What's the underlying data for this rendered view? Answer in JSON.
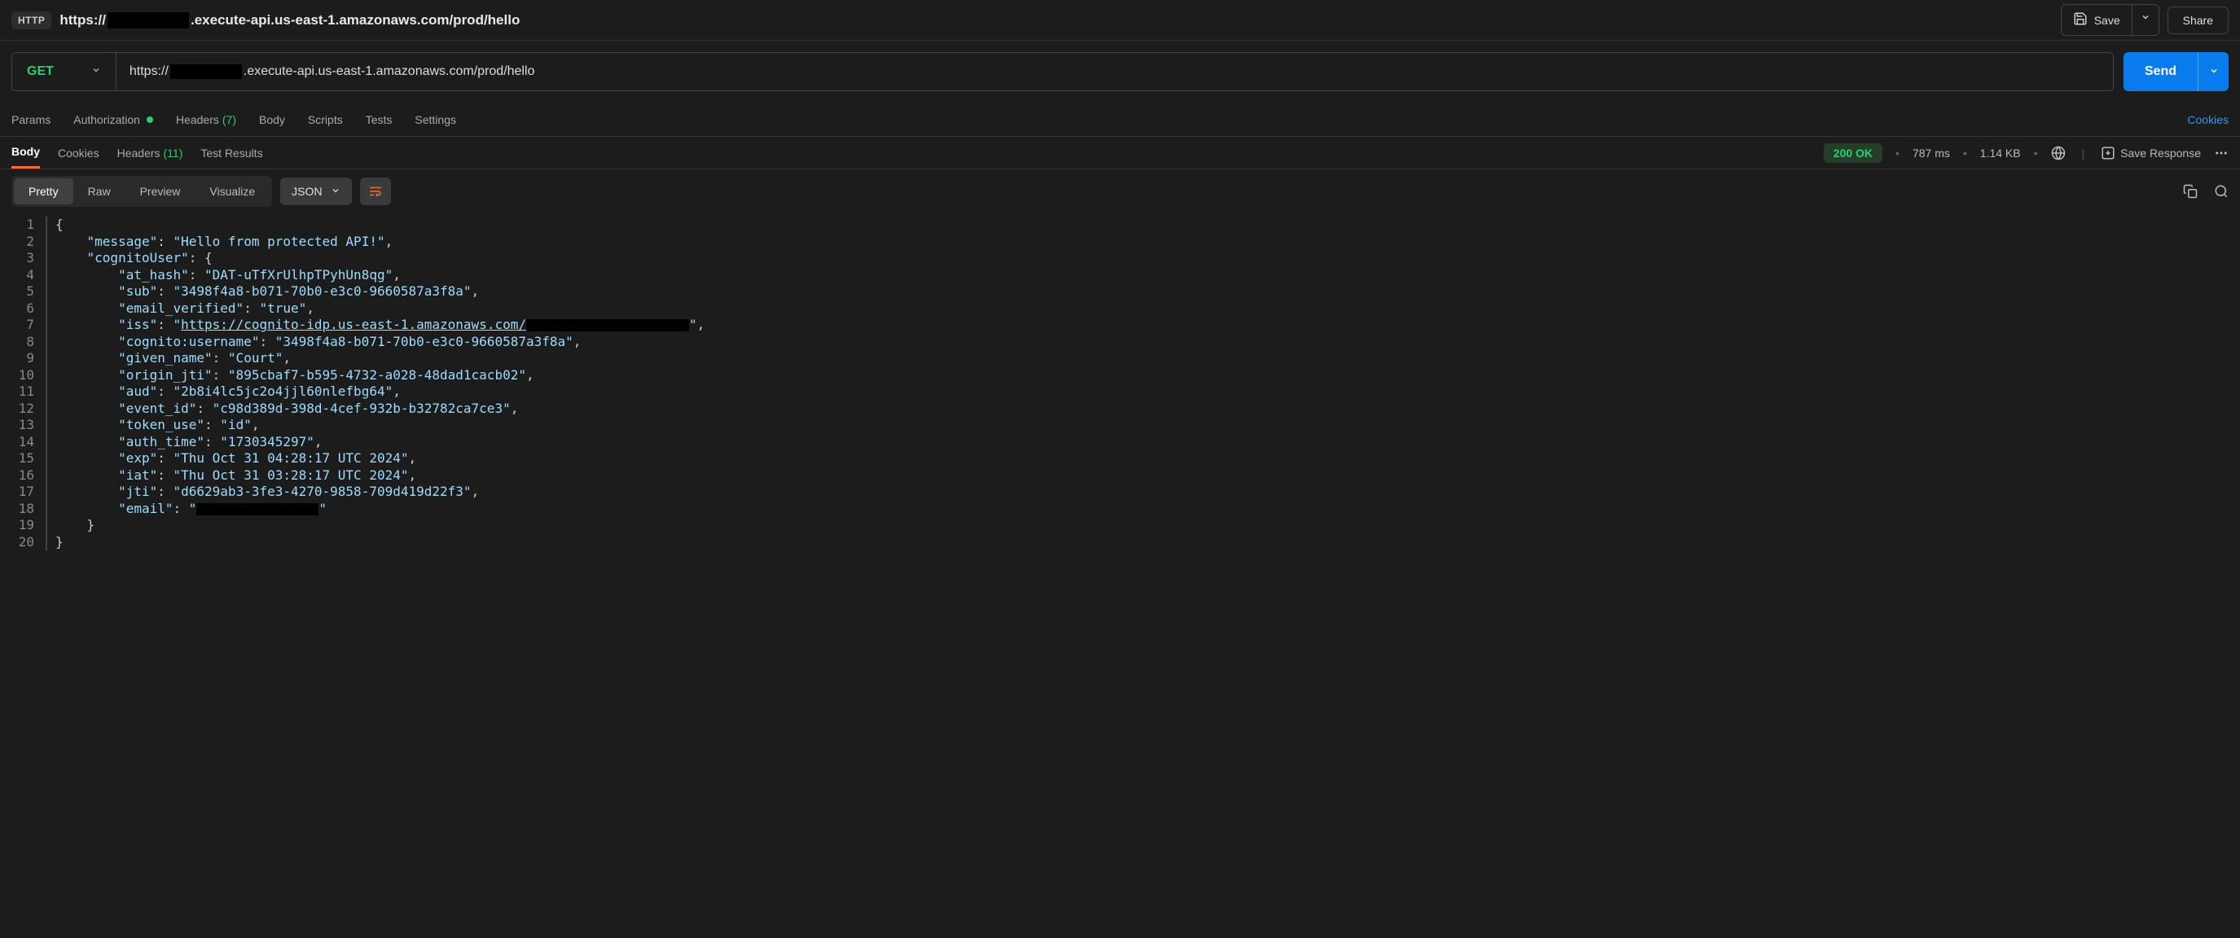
{
  "titlebar": {
    "badge": "HTTP",
    "url_prefix": "https://",
    "url_suffix": ".execute-api.us-east-1.amazonaws.com/prod/hello",
    "save": "Save",
    "share": "Share"
  },
  "request": {
    "method": "GET",
    "url_prefix": "https://",
    "url_suffix": ".execute-api.us-east-1.amazonaws.com/prod/hello",
    "send": "Send"
  },
  "req_tabs": {
    "params": "Params",
    "authorization": "Authorization",
    "headers": "Headers",
    "headers_count": "(7)",
    "body": "Body",
    "scripts": "Scripts",
    "tests": "Tests",
    "settings": "Settings",
    "cookies": "Cookies"
  },
  "resp_tabs": {
    "body": "Body",
    "cookies": "Cookies",
    "headers": "Headers",
    "headers_count": "(11)",
    "test_results": "Test Results"
  },
  "status": {
    "code": "200 OK",
    "time": "787 ms",
    "size": "1.14 KB",
    "save_response": "Save Response"
  },
  "format": {
    "pretty": "Pretty",
    "raw": "Raw",
    "preview": "Preview",
    "visualize": "Visualize",
    "json": "JSON"
  },
  "json_body": {
    "lines": 20,
    "l1": "{",
    "l2_k": "\"message\"",
    "l2_v": "\"Hello from protected API!\"",
    "l3_k": "\"cognitoUser\"",
    "l4_k": "\"at_hash\"",
    "l4_v": "\"DAT-uTfXrUlhpTPyhUn8qg\"",
    "l5_k": "\"sub\"",
    "l5_v": "\"3498f4a8-b071-70b0-e3c0-9660587a3f8a\"",
    "l6_k": "\"email_verified\"",
    "l6_v": "\"true\"",
    "l7_k": "\"iss\"",
    "l7_v_pre": "\"",
    "l7_link": "https://cognito-idp.us-east-1.amazonaws.com/",
    "l7_v_post": "\"",
    "l8_k": "\"cognito:username\"",
    "l8_v": "\"3498f4a8-b071-70b0-e3c0-9660587a3f8a\"",
    "l9_k": "\"given_name\"",
    "l9_v": "\"Court\"",
    "l10_k": "\"origin_jti\"",
    "l10_v": "\"895cbaf7-b595-4732-a028-48dad1cacb02\"",
    "l11_k": "\"aud\"",
    "l11_v": "\"2b8i4lc5jc2o4jjl60nlefbg64\"",
    "l12_k": "\"event_id\"",
    "l12_v": "\"c98d389d-398d-4cef-932b-b32782ca7ce3\"",
    "l13_k": "\"token_use\"",
    "l13_v": "\"id\"",
    "l14_k": "\"auth_time\"",
    "l14_v": "\"1730345297\"",
    "l15_k": "\"exp\"",
    "l15_v": "\"Thu Oct 31 04:28:17 UTC 2024\"",
    "l16_k": "\"iat\"",
    "l16_v": "\"Thu Oct 31 03:28:17 UTC 2024\"",
    "l17_k": "\"jti\"",
    "l17_v": "\"d6629ab3-3fe3-4270-9858-709d419d22f3\"",
    "l18_k": "\"email\"",
    "l19": "    }",
    "l20": "}"
  }
}
